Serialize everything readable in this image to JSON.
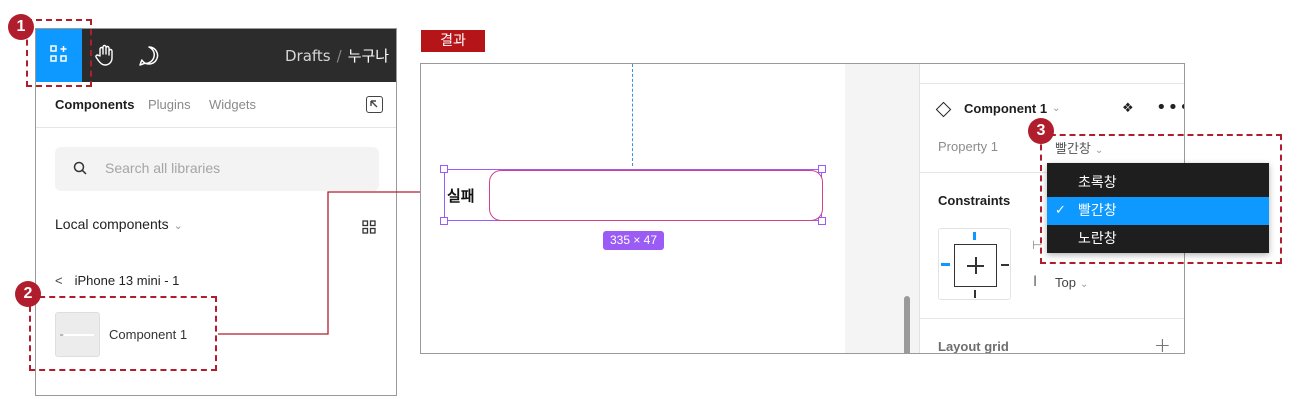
{
  "left_panel": {
    "breadcrumb": {
      "root": "Drafts",
      "separator": "/",
      "file": "누구나"
    },
    "tabs": [
      "Components",
      "Plugins",
      "Widgets"
    ],
    "search": {
      "placeholder": "Search all libraries"
    },
    "local_components": {
      "label": "Local components"
    },
    "page": {
      "name": "iPhone 13 mini - 1"
    },
    "component": {
      "name": "Component 1"
    }
  },
  "annotations": {
    "marker_1": "1",
    "marker_2": "2",
    "marker_3": "3",
    "result_label": "결과"
  },
  "canvas": {
    "field_label": "실패",
    "size_badge": "335 × 47"
  },
  "properties": {
    "component_title": "Component 1",
    "property_label": "Property 1",
    "property_value": "빨간창",
    "constraints_title": "Constraints",
    "vertical_constraint": "Top",
    "layout_grid_title": "Layout grid"
  },
  "dropdown": {
    "options": [
      "초록창",
      "빨간창",
      "노란창"
    ],
    "selected": "빨간창"
  },
  "colors": {
    "accent_blue": "#0d99ff",
    "annotation_red": "#b01e2e",
    "selection_purple": "#9b5cf6",
    "field_border": "#d4408a"
  },
  "icons": [
    "assets-icon",
    "hand-icon",
    "comment-icon",
    "collapse-icon",
    "search-icon",
    "grid-view-icon",
    "back-chevron-icon",
    "component-diamond-icon",
    "instance-icon",
    "more-icon",
    "plus-icon",
    "check-icon"
  ]
}
